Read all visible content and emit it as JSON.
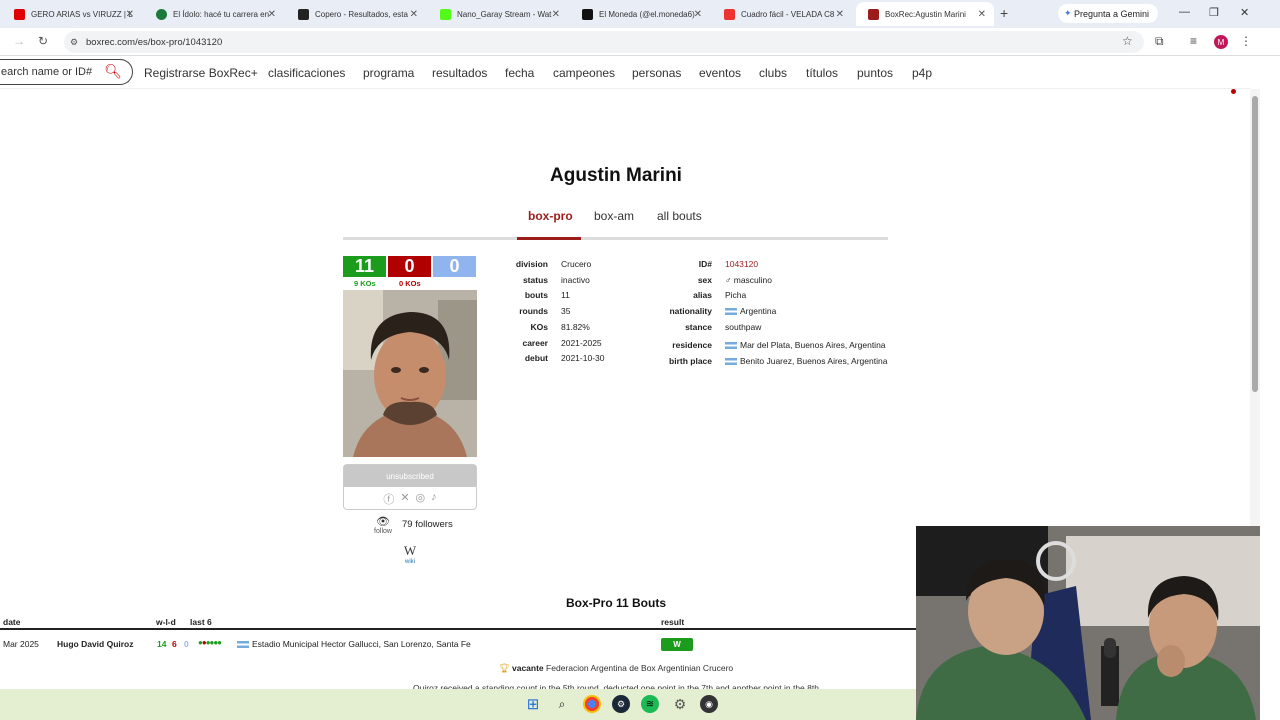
{
  "browser": {
    "tabs": [
      {
        "title": "GERO ARIAS vs VIRUZZ | L",
        "color": "#e00000"
      },
      {
        "title": "El Ídolo: hacé tu carrera en",
        "color": "#1b7a3a"
      },
      {
        "title": "Copero - Resultados, esta",
        "color": "#222222"
      },
      {
        "title": "Nano_Garay Stream - Wat",
        "color": "#53fc18"
      },
      {
        "title": "El Moneda (@el.moneda6)",
        "color": "#111111"
      },
      {
        "title": "Cuadro fácil - VELADA C8",
        "color": "#e33"
      },
      {
        "title": "BoxRec:Agustin Marini",
        "color": "#9c1c1c"
      }
    ],
    "new_tab": "+",
    "gemini": "Pregunta a Gemini",
    "url": "boxrec.com/es/box-pro/1043120",
    "profile_initial": "M"
  },
  "site": {
    "search_placeholder": "earch name or ID#",
    "nav": [
      "Registrarse BoxRec+",
      "clasificaciones",
      "programa",
      "resultados",
      "fecha",
      "campeones",
      "personas",
      "eventos",
      "clubs",
      "títulos",
      "puntos",
      "p4p"
    ]
  },
  "profile": {
    "name": "Agustin Marini",
    "tabs": [
      "box-pro",
      "box-am",
      "all bouts"
    ],
    "record": {
      "wins": "11",
      "losses": "0",
      "draws": "0",
      "wins_kos": "9 KOs",
      "losses_kos": "0 KOs"
    },
    "subscription": "unsubscribed",
    "follow_label": "follow",
    "followers": "79 followers",
    "wiki_label": "wiki",
    "left_details": [
      {
        "label": "division",
        "value": "Crucero"
      },
      {
        "label": "status",
        "value": "inactivo"
      },
      {
        "label": "bouts",
        "value": "11"
      },
      {
        "label": "rounds",
        "value": "35"
      },
      {
        "label": "KOs",
        "value": "81.82%"
      },
      {
        "label": "career",
        "value": "2021-2025"
      },
      {
        "label": "debut",
        "value": "2021-10-30"
      }
    ],
    "right_details": [
      {
        "label": "ID#",
        "value": "1043120"
      },
      {
        "label": "sex",
        "value": "♂ masculino"
      },
      {
        "label": "alias",
        "value": "Picha"
      },
      {
        "label": "nationality",
        "value": "Argentina"
      },
      {
        "label": "stance",
        "value": "southpaw"
      },
      {
        "label": "residence",
        "value": "Mar del Plata, Buenos Aires, Argentina"
      },
      {
        "label": "birth place",
        "value": "Benito Juarez, Buenos Aires, Argentina"
      }
    ]
  },
  "bouts": {
    "title": "Box-Pro 11 Bouts",
    "headers": {
      "date": "date",
      "wld": "w-l-d",
      "last6": "last 6",
      "result": "result"
    },
    "rows": [
      {
        "date": "Mar 2025",
        "opponent": "Hugo David Quiroz",
        "w": "14",
        "l": "6",
        "d": "0",
        "venue": "Estadio Municipal Hector Gallucci, San Lorenzo, Santa Fe",
        "result": "W"
      }
    ],
    "title_fight": {
      "label": "vacante",
      "title": "Federacion Argentina de Box Argentinian Crucero"
    },
    "note": "Quiroz received a standing count in the 5th round, deducted one point in the 7th and another point in the 8th"
  }
}
